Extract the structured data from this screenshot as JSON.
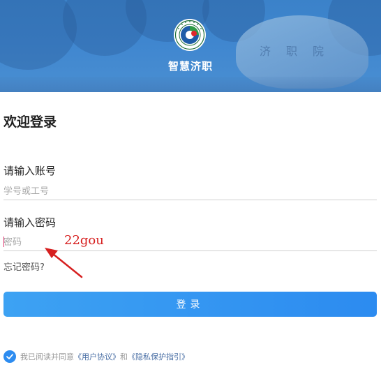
{
  "header": {
    "app_name": "智慧济职",
    "logo_icon": "school-emblem-icon",
    "rock_inscription": "济职院"
  },
  "login": {
    "welcome_title": "欢迎登录",
    "account_label": "请输入账号",
    "account_placeholder": "学号或工号",
    "account_value": "",
    "password_label": "请输入密码",
    "password_placeholder": "密码",
    "password_value": "",
    "forgot_password": "忘记密码?",
    "submit_label": "登录"
  },
  "agreement": {
    "checked": true,
    "prefix": "我已阅读并同意",
    "user_agreement": "《用户协议》",
    "connector": "和",
    "privacy_guide": "《隐私保护指引》"
  },
  "annotation": {
    "text": "22gou",
    "color": "#d61f1f"
  },
  "colors": {
    "banner": "#3f86cf",
    "button": "#2c8bf0",
    "checkbox": "#2d8cf0",
    "cursor": "#e0306b"
  }
}
